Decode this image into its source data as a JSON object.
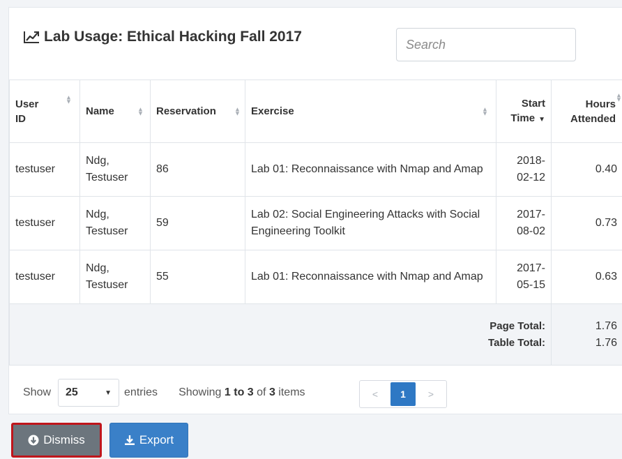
{
  "header": {
    "title": "Lab Usage: Ethical Hacking Fall 2017",
    "icon": "line-chart-icon"
  },
  "search": {
    "placeholder": "Search",
    "value": ""
  },
  "table": {
    "columns": {
      "user_id": "User ID",
      "name": "Name",
      "reservation": "Reservation",
      "exercise": "Exercise",
      "start_time": "Start Time",
      "hours_attended": "Hours Attended"
    },
    "sorted_column": "start_time",
    "sort_direction": "descending",
    "rows": [
      {
        "user_id": "testuser",
        "name": "Ndg, Testuser",
        "reservation": "86",
        "exercise": "Lab 01: Reconnaissance with Nmap and Amap",
        "start_time": "2018-02-12",
        "hours_attended": "0.40"
      },
      {
        "user_id": "testuser",
        "name": "Ndg, Testuser",
        "reservation": "59",
        "exercise": "Lab 02: Social Engineering Attacks with Social Engineering Toolkit",
        "start_time": "2017-08-02",
        "hours_attended": "0.73"
      },
      {
        "user_id": "testuser",
        "name": "Ndg, Testuser",
        "reservation": "55",
        "exercise": "Lab 01: Reconnaissance with Nmap and Amap",
        "start_time": "2017-05-15",
        "hours_attended": "0.63"
      }
    ],
    "totals": {
      "page_total_label": "Page Total:",
      "page_total_value": "1.76",
      "table_total_label": "Table Total:",
      "table_total_value": "1.76"
    }
  },
  "footer": {
    "show_label": "Show",
    "page_length": "25",
    "entries_label": "entries",
    "info_prefix": "Showing",
    "info_range": "1 to 3",
    "info_of": "of",
    "info_count": "3",
    "info_suffix": "items",
    "pagination": {
      "prev": "<",
      "current": "1",
      "next": ">"
    }
  },
  "actions": {
    "dismiss_label": "Dismiss",
    "dismiss_icon": "arrow-circle-down-icon",
    "export_label": "Export",
    "export_icon": "download-icon"
  },
  "colors": {
    "primary": "#3a80c8",
    "pager_active": "#2e78c4",
    "dismiss": "#6c757d",
    "highlight_border": "#c0151b",
    "total_row_bg": "#f2f4f7"
  }
}
